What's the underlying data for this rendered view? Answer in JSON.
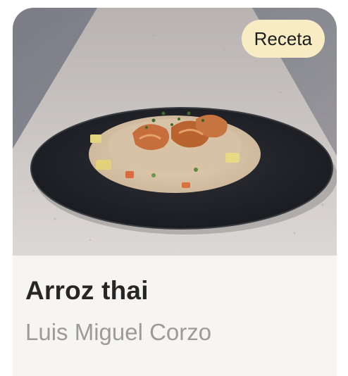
{
  "card": {
    "badge": "Receta",
    "title": "Arroz thai",
    "author": "Luis Miguel Corzo",
    "image_alt": "plato de arroz thai con camarones"
  },
  "colors": {
    "badge_bg": "#f8ecc4",
    "title": "#262626",
    "author": "#9b9b9b",
    "card_bg": "#f6f5f3"
  }
}
